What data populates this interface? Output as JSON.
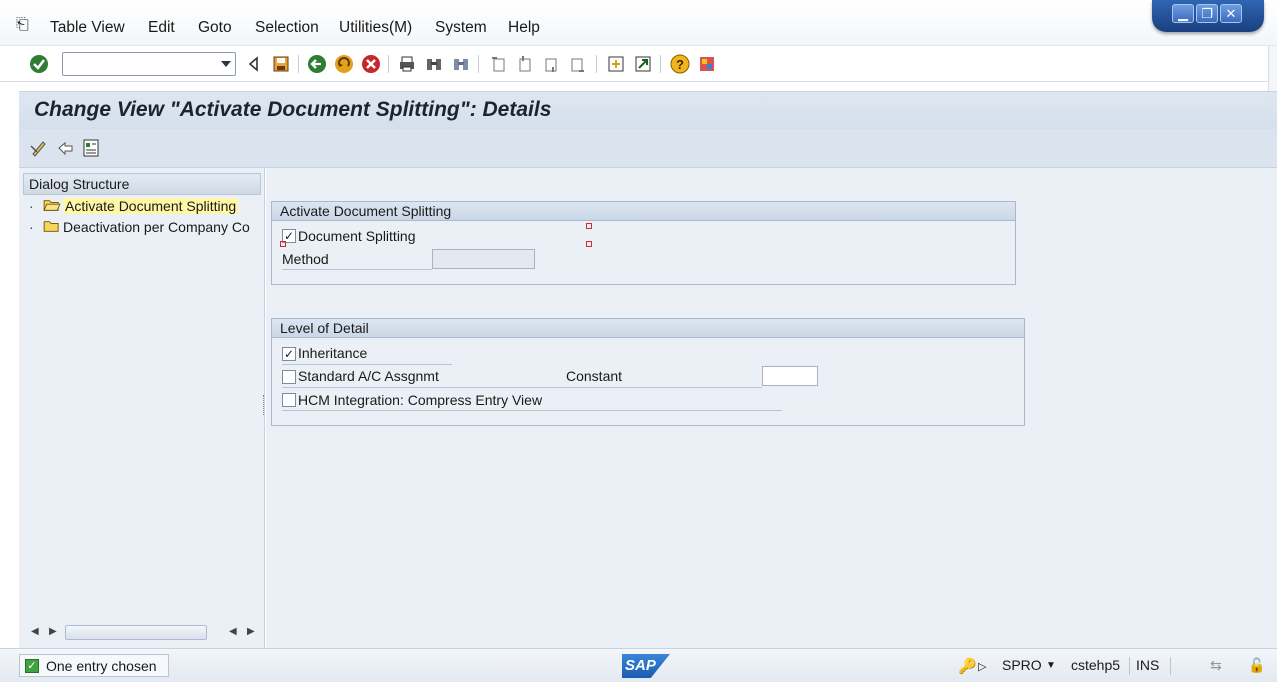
{
  "menubar": {
    "items": [
      "Table View",
      "Edit",
      "Goto",
      "Selection",
      "Utilities(M)",
      "System",
      "Help"
    ]
  },
  "toolbar": {
    "command_field_value": "",
    "icons": [
      "enter-icon",
      "back-icon",
      "save-icon",
      "back-arrow-icon",
      "exit-icon",
      "cancel-icon",
      "print-icon",
      "find-icon",
      "find-next-icon",
      "first-page-icon",
      "previous-page-icon",
      "next-page-icon",
      "last-page-icon",
      "create-session-icon",
      "shortcut-icon",
      "help-icon",
      "customize-layout-icon"
    ]
  },
  "title": {
    "text": "Change View \"Activate Document Splitting\": Details"
  },
  "app_toolbar": {
    "icons": [
      "display-change-icon",
      "undo-icon",
      "details-icon"
    ]
  },
  "dialog_structure": {
    "header": "Dialog Structure",
    "items": [
      {
        "label": "Activate Document Splitting",
        "selected": true,
        "open": true
      },
      {
        "label": "Deactivation per Company Co",
        "selected": false,
        "open": false
      }
    ]
  },
  "group_activate": {
    "title": "Activate Document Splitting",
    "document_splitting_label": "Document Splitting",
    "document_splitting_checked": true,
    "method_label": "Method",
    "method_value": ""
  },
  "group_detail": {
    "title": "Level of Detail",
    "inheritance_label": "Inheritance",
    "inheritance_checked": true,
    "standard_label": "Standard A/C Assgnmt",
    "standard_checked": false,
    "constant_label": "Constant",
    "constant_value": "",
    "hcm_label": "HCM Integration: Compress Entry View",
    "hcm_checked": false
  },
  "statusbar": {
    "message": "One entry chosen",
    "logo": "SAP",
    "transaction": "SPRO",
    "server": "cstehp5",
    "mode": "INS"
  },
  "colors": {
    "title_bg": "#dfe7f1",
    "pane_bg": "#eaf0f6",
    "selected_bg": "#fff6a6",
    "window_controls": "#2f66b3"
  }
}
